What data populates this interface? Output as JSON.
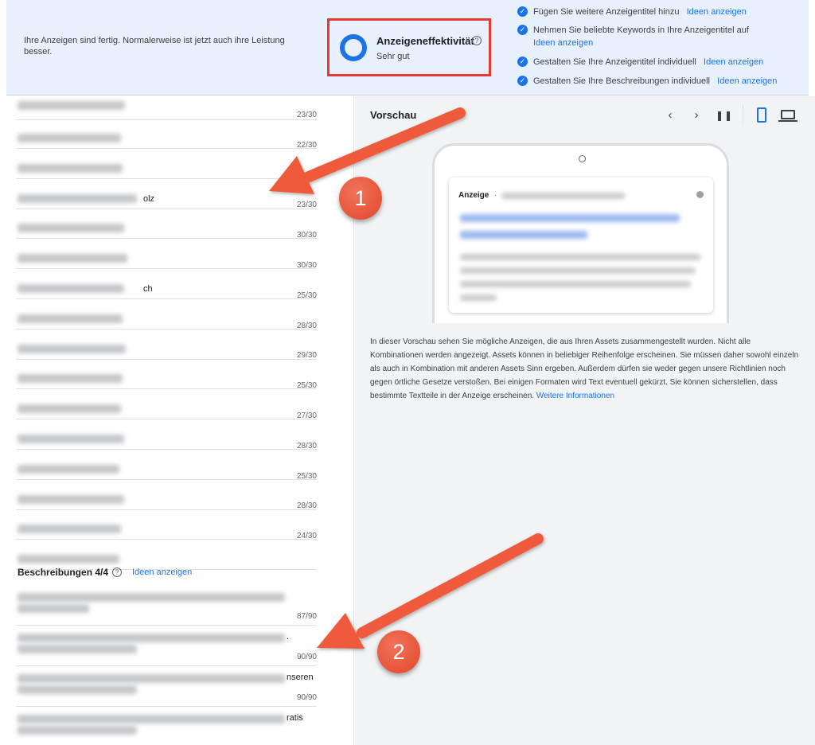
{
  "banner": {
    "message": "Ihre Anzeigen sind fertig. Normalerweise ist jetzt auch ihre Leistung besser.",
    "effectiveness": {
      "title": "Anzeigeneffektivität",
      "help_icon": "question-circle-icon",
      "rating": "Sehr gut",
      "ring_icon": "effectiveness-ring-icon",
      "ring_color": "#1a73e8",
      "highlight_color": "#e53935"
    },
    "suggestions": [
      {
        "text": "Fügen Sie weitere Anzeigentitel hinzu",
        "link": "Ideen anzeigen"
      },
      {
        "text": "Nehmen Sie beliebte Keywords in Ihre Anzeigentitel auf",
        "link": "Ideen anzeigen"
      },
      {
        "text": "Gestalten Sie Ihre Anzeigentitel individuell",
        "link": "Ideen anzeigen"
      },
      {
        "text": "Gestalten Sie Ihre Beschreibungen individuell",
        "link": "Ideen anzeigen"
      }
    ],
    "check_icon": "check-circle-icon"
  },
  "headlines": {
    "rows": [
      {
        "fragment": "",
        "count": "23/30"
      },
      {
        "fragment": "",
        "count": "22/30"
      },
      {
        "fragment": "olz",
        "count": "30/30"
      },
      {
        "fragment": "",
        "count": "23/30"
      },
      {
        "fragment": "",
        "count": "30/30"
      },
      {
        "fragment": "ch",
        "count": "30/30"
      },
      {
        "fragment": "",
        "count": "25/30"
      },
      {
        "fragment": "",
        "count": "28/30"
      },
      {
        "fragment": "",
        "count": "29/30"
      },
      {
        "fragment": "",
        "count": "25/30"
      },
      {
        "fragment": "",
        "count": "27/30"
      },
      {
        "fragment": "",
        "count": "28/30"
      },
      {
        "fragment": "",
        "count": "25/30"
      },
      {
        "fragment": "",
        "count": "28/30"
      },
      {
        "fragment": "",
        "count": "24/30"
      }
    ]
  },
  "descriptions": {
    "heading": "Beschreibungen 4/4",
    "help_icon": "question-circle-icon",
    "link": "Ideen anzeigen",
    "rows": [
      {
        "fragment": "",
        "count": "87/90"
      },
      {
        "fragment": ".",
        "count": "90/90"
      },
      {
        "fragment": "nseren",
        "count": "90/90"
      },
      {
        "fragment": "ratis",
        "count": ""
      }
    ]
  },
  "preview": {
    "title": "Vorschau",
    "controls": [
      "chevron-left-icon",
      "chevron-right-icon",
      "pause-icon",
      "mobile-device-icon",
      "laptop-icon"
    ],
    "ad_label": "Anzeige",
    "ad_separator": "·",
    "note": "In dieser Vorschau sehen Sie mögliche Anzeigen, die aus Ihren Assets zusammengestellt wurden. Nicht alle Kombinationen werden angezeigt. Assets können in beliebiger Reihenfolge erscheinen. Sie müssen daher sowohl einzeln als auch in Kombination mit anderen Assets Sinn ergeben. Außerdem dürfen sie weder gegen unsere Richtlinien noch gegen örtliche Gesetze verstoßen. Bei einigen Formaten wird Text eventuell gekürzt. Sie können sicherstellen, dass bestimmte Textteile in der Anzeige erscheinen.",
    "note_link": "Weitere Informationen"
  },
  "annotations": {
    "badges": [
      "1",
      "2"
    ],
    "arrow_color": "#ef5a3c"
  }
}
